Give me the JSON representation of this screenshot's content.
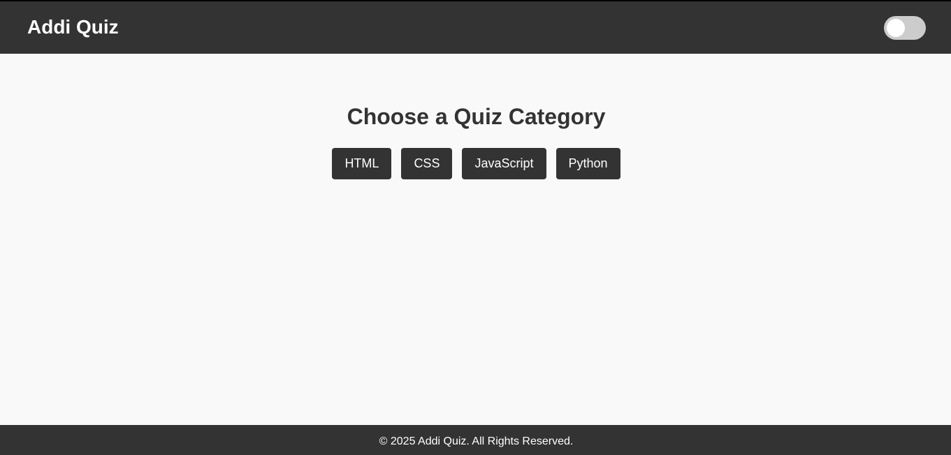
{
  "header": {
    "title": "Addi Quiz",
    "theme_toggle": {
      "state": "off",
      "track_color": "#cccccc",
      "knob_color": "#ffffff"
    }
  },
  "main": {
    "title": "Choose a Quiz Category",
    "categories": [
      {
        "label": "HTML"
      },
      {
        "label": "CSS"
      },
      {
        "label": "JavaScript"
      },
      {
        "label": "Python"
      }
    ]
  },
  "footer": {
    "text": "© 2025 Addi Quiz. All Rights Reserved."
  },
  "colors": {
    "header_bg": "#333333",
    "page_bg": "#f9f9f9",
    "button_bg": "#333333",
    "text_light": "#ffffff",
    "text_dark": "#333333"
  }
}
